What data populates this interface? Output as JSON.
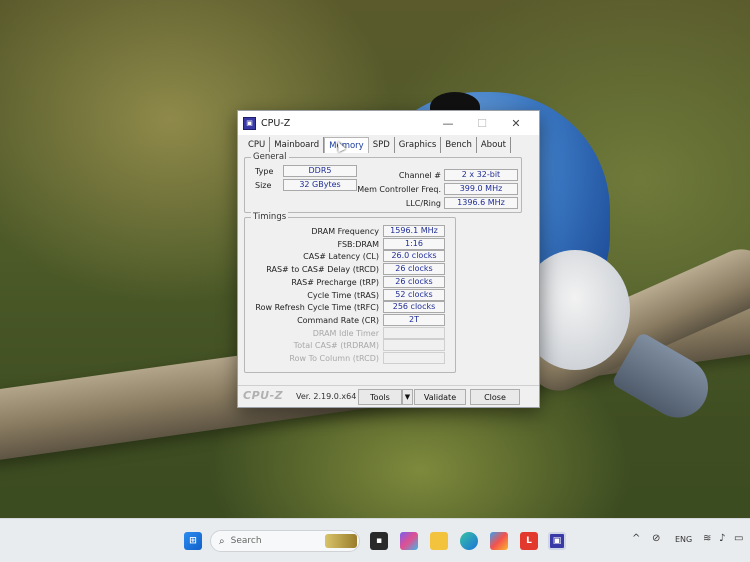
{
  "window": {
    "title": "CPU-Z",
    "icon": "cpuz-icon",
    "controls": {
      "minimize": "—",
      "maximize": "☐",
      "close": "✕"
    },
    "tabs": [
      "CPU",
      "Mainboard",
      "Memory",
      "SPD",
      "Graphics",
      "Bench",
      "About"
    ],
    "active_tab": "Memory",
    "general": {
      "label": "General",
      "type_label": "Type",
      "type_value": "DDR5",
      "size_label": "Size",
      "size_value": "32 GBytes",
      "channel_label": "Channel #",
      "channel_value": "2 x 32-bit",
      "memctrl_label": "Mem Controller Freq.",
      "memctrl_value": "399.0 MHz",
      "llc_label": "LLC/Ring",
      "llc_value": "1396.6 MHz"
    },
    "timings": {
      "label": "Timings",
      "rows": [
        {
          "label": "DRAM Frequency",
          "value": "1596.1 MHz",
          "enabled": true
        },
        {
          "label": "FSB:DRAM",
          "value": "1:16",
          "enabled": true
        },
        {
          "label": "CAS# Latency (CL)",
          "value": "26.0 clocks",
          "enabled": true
        },
        {
          "label": "RAS# to CAS# Delay (tRCD)",
          "value": "26 clocks",
          "enabled": true
        },
        {
          "label": "RAS# Precharge (tRP)",
          "value": "26 clocks",
          "enabled": true
        },
        {
          "label": "Cycle Time (tRAS)",
          "value": "52 clocks",
          "enabled": true
        },
        {
          "label": "Row Refresh Cycle Time (tRFC)",
          "value": "256 clocks",
          "enabled": true
        },
        {
          "label": "Command Rate (CR)",
          "value": "2T",
          "enabled": true
        },
        {
          "label": "DRAM Idle Timer",
          "value": "",
          "enabled": false
        },
        {
          "label": "Total CAS# (tRDRAM)",
          "value": "",
          "enabled": false
        },
        {
          "label": "Row To Column (tRCD)",
          "value": "",
          "enabled": false
        }
      ]
    },
    "footer": {
      "brand": "CPU-Z",
      "version": "Ver. 2.19.0.x64",
      "tools_label": "Tools",
      "tools_arrow": "▼",
      "validate_label": "Validate",
      "close_label": "Close"
    }
  },
  "taskbar": {
    "search_placeholder": "Search",
    "search_icon": "search-icon",
    "apps": [
      "widgets-icon",
      "task-view-icon",
      "copilot-icon",
      "file-explorer-icon",
      "edge-icon",
      "store-icon",
      "app-l-icon",
      "cpuz-taskbar-icon"
    ],
    "app_l_letter": "L",
    "tray": {
      "chevron": "^",
      "language": "ENG"
    }
  }
}
